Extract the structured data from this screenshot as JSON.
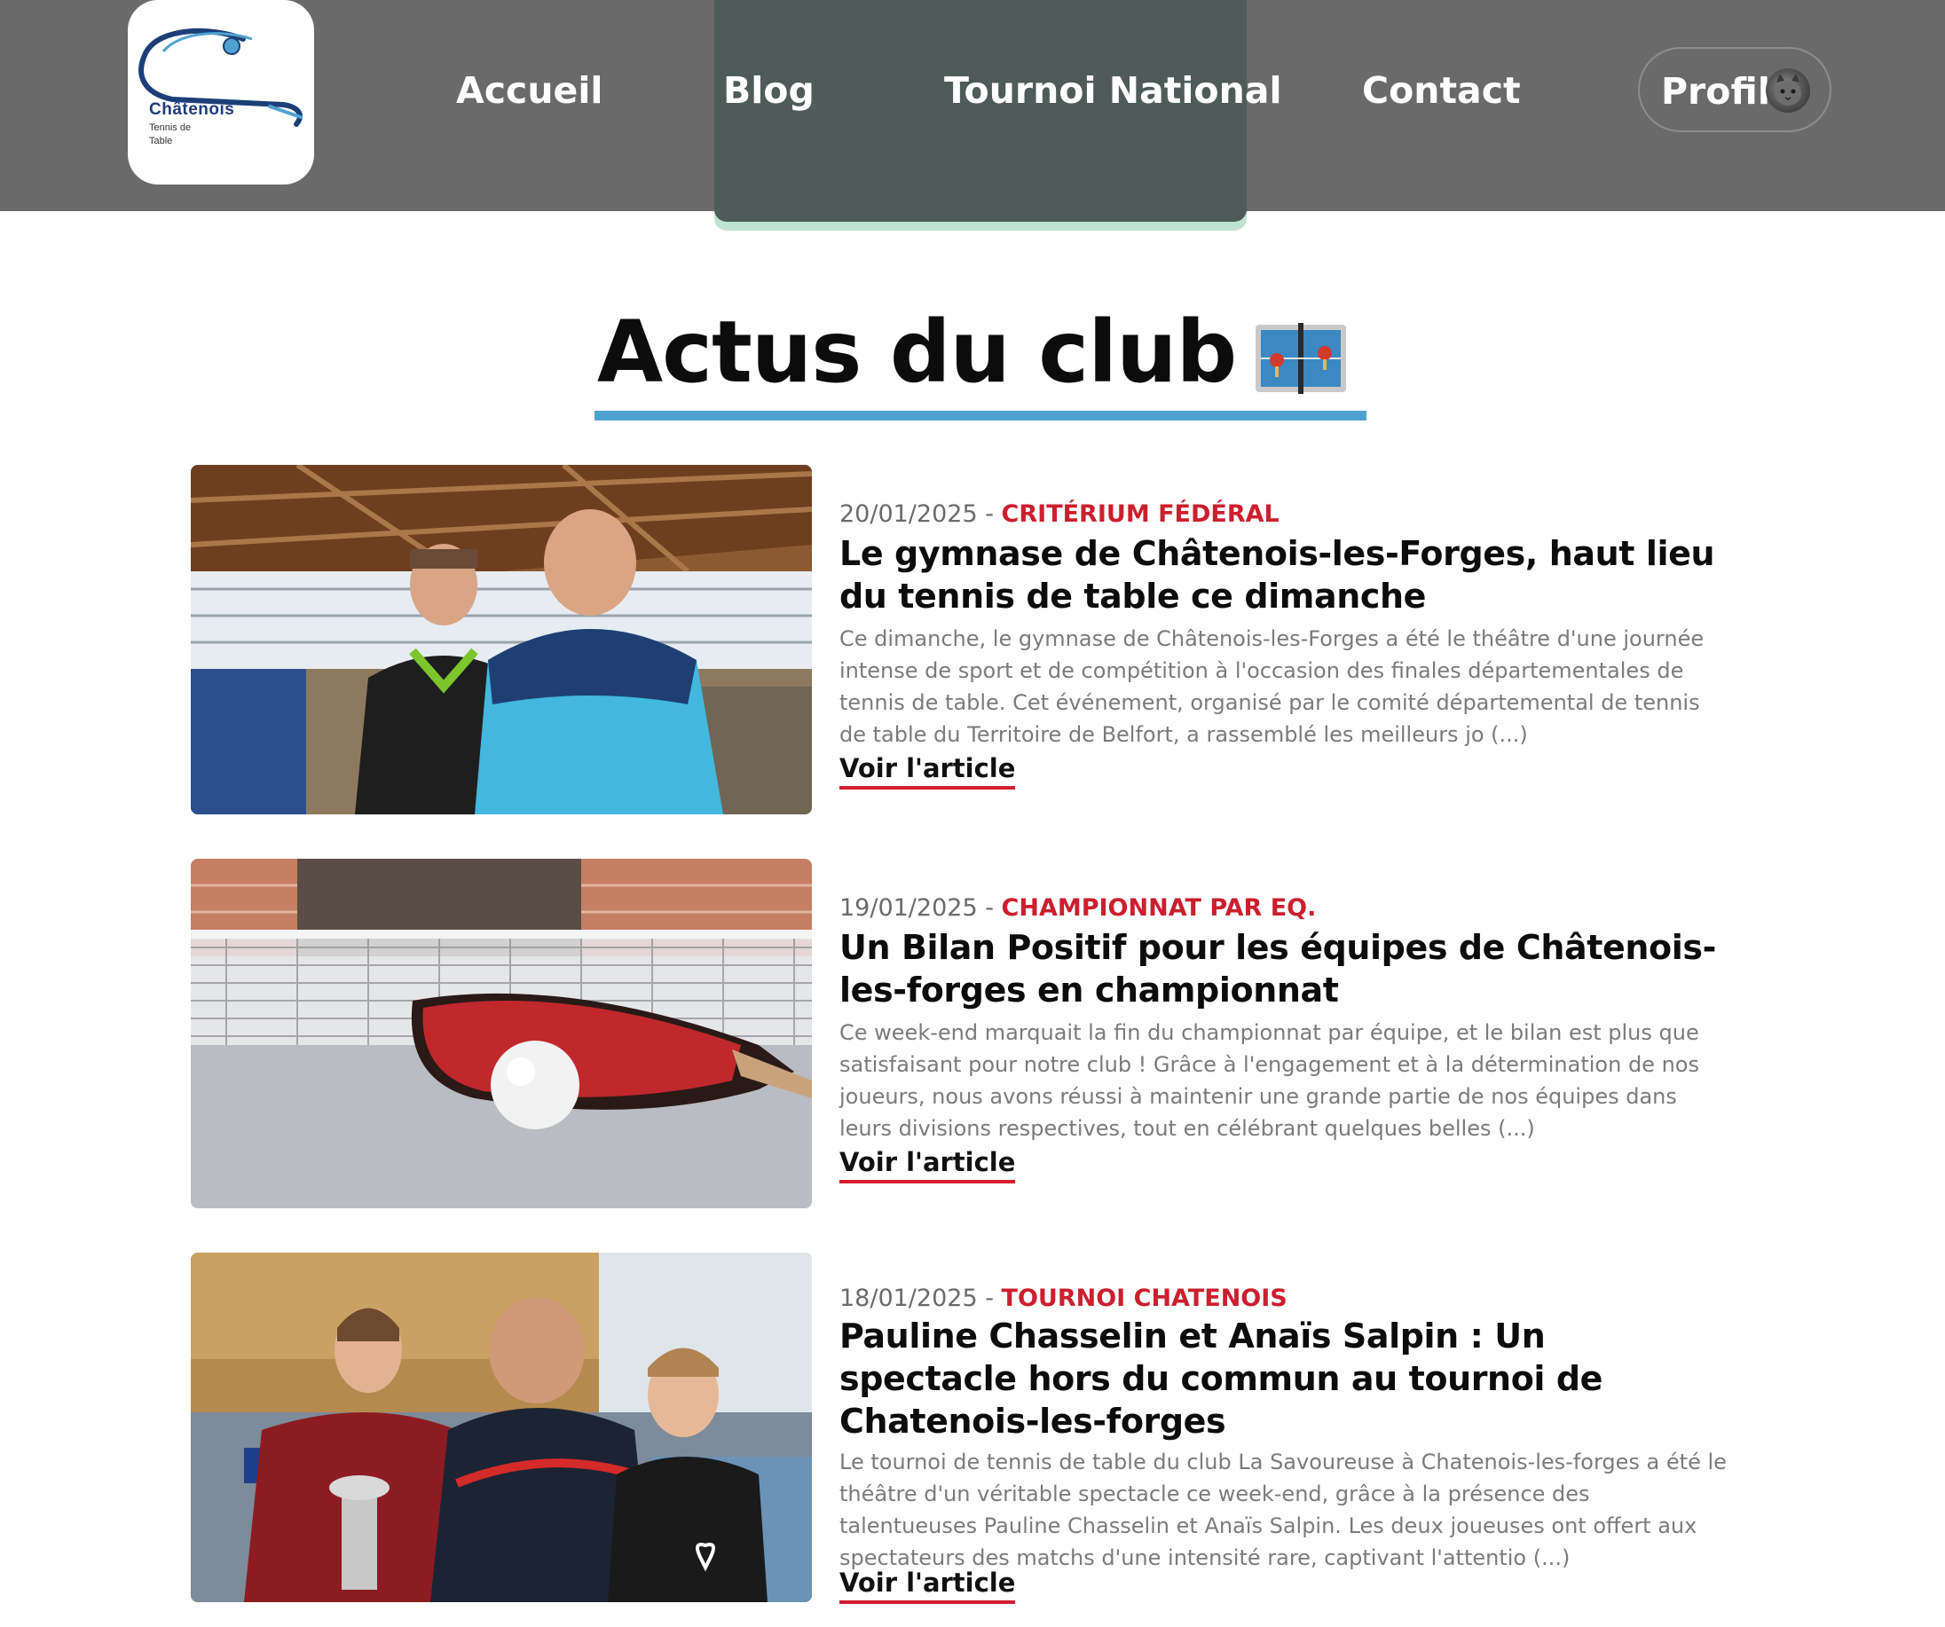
{
  "header": {
    "logo": {
      "line1": "Châtenois",
      "line2": "Tennis de",
      "line3": "Table"
    },
    "nav": [
      {
        "label": "Accueil"
      },
      {
        "label": "Blog"
      },
      {
        "label": "Tournoi National"
      },
      {
        "label": "Contact"
      }
    ],
    "active_nav": "Tournoi National",
    "profile": {
      "label": "Profil"
    }
  },
  "page": {
    "title": "Actus du club",
    "title_icon": "ping-pong-table-icon",
    "accent_color": "#4fa2cf",
    "category_color": "#cc1f2d"
  },
  "articles": [
    {
      "date": "20/01/2025",
      "separator": " - ",
      "category": "CRITÉRIUM FÉDÉRAL",
      "title": "Le gymnase de Châtenois-les-Forges, haut lieu du tennis de table ce dimanche",
      "excerpt": "Ce dimanche, le gymnase de Châtenois-les-Forges a été le théâtre d'une journée intense de sport et de compétition à l'occasion des finales départementales de tennis de table. Cet événement, organisé par le comité départemental de tennis de table du Territoire de Belfort, a rassemblé les meilleurs jo (...)",
      "link": "Voir l'article",
      "image": "two-men-in-gymnasium-photo"
    },
    {
      "date": "19/01/2025",
      "separator": " - ",
      "category": "CHAMPIONNAT PAR EQ.",
      "title": "Un Bilan Positif pour les équipes de Châtenois-les-forges en championnat",
      "excerpt": "Ce week-end marquait la fin du championnat par équipe, et le bilan est plus que satisfaisant pour notre club ! Grâce à l'engagement et à la détermination de nos joueurs, nous avons réussi à maintenir une grande partie de nos équipes dans leurs divisions respectives, tout en célébrant quelques belles (...)",
      "link": "Voir l'article",
      "image": "paddle-and-ball-on-table-photo"
    },
    {
      "date": "18/01/2025",
      "separator": " - ",
      "category": "TOURNOI CHATENOIS",
      "title": "Pauline Chasselin et Anaïs Salpin : Un spectacle hors du commun au tournoi de Chatenois-les-forges",
      "excerpt": "Le tournoi de tennis de table du club La Savoureuse à Chatenois-les-forges a été le théâtre d'un véritable spectacle ce week-end, grâce à la présence des talentueuses Pauline Chasselin et Anaïs Salpin. Les deux joueuses ont offert aux spectateurs des matchs d'une intensité rare, captivant l'attentio (...)",
      "link": "Voir l'article",
      "image": "players-with-trophy-photo"
    }
  ]
}
